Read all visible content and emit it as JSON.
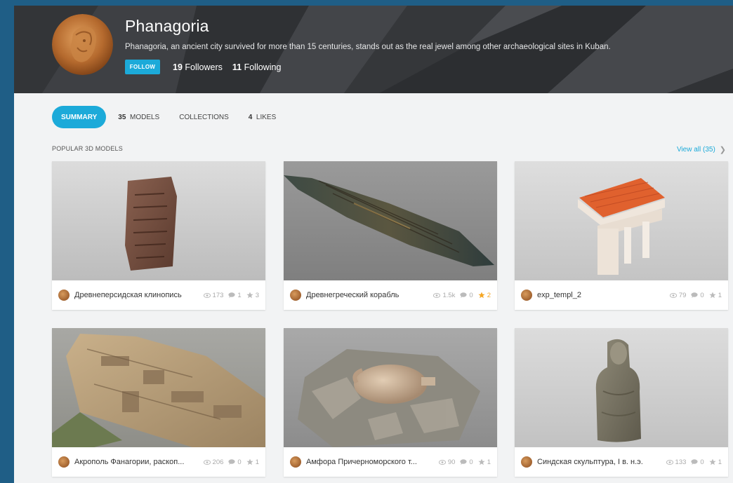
{
  "profile": {
    "name": "Phanagoria",
    "description": "Phanagoria, an ancient city survived for more than 15 centuries, stands out as the real jewel among other archaeological sites in Kuban.",
    "follow_label": "FOLLOW",
    "followers_count": "19",
    "followers_label": "Followers",
    "following_count": "11",
    "following_label": "Following"
  },
  "tabs": {
    "summary": "SUMMARY",
    "models_count": "35",
    "models_label": "MODELS",
    "collections": "COLLECTIONS",
    "likes_count": "4",
    "likes_label": "LIKES"
  },
  "section": {
    "title": "POPULAR 3D MODELS",
    "view_all": "View all (35)"
  },
  "models": [
    {
      "title": "Древнеперсидская клинопись",
      "views": "173",
      "comments": "1",
      "likes": "3",
      "icon": "cuneiform-tablet"
    },
    {
      "title": "Древнегреческий корабль",
      "views": "1.5k",
      "comments": "0",
      "likes": "2",
      "icon": "ancient-ship"
    },
    {
      "title": "exp_templ_2",
      "views": "79",
      "comments": "0",
      "likes": "1",
      "icon": "temple"
    },
    {
      "title": "Акрополь Фанагории, раскоп...",
      "views": "206",
      "comments": "0",
      "likes": "1",
      "icon": "excavation"
    },
    {
      "title": "Амфора Причерноморского т...",
      "views": "90",
      "comments": "0",
      "likes": "1",
      "icon": "amphora"
    },
    {
      "title": "Синдская скульптура, I в. н.э.",
      "views": "133",
      "comments": "0",
      "likes": "1",
      "icon": "sculpture"
    }
  ],
  "colors": {
    "accent": "#1caad9",
    "header_bg": "#3a3c3f",
    "page_bg": "#f2f3f4",
    "star_highlight": "#f5a623"
  }
}
